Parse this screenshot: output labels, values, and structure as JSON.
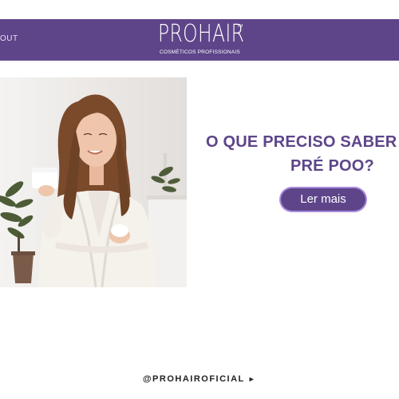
{
  "header": {
    "nav_left": "OUT",
    "logo": {
      "title": "PROHAIR",
      "trademark": "TM",
      "subtitle": "COSMÉTICOS PROFISSIONAIS"
    },
    "background_color": "#5e4589"
  },
  "hero": {
    "headline_line1": "O QUE PRECISO SABER",
    "headline_line2": "PRÉ POO?",
    "button_label": "Ler mais"
  },
  "footer": {
    "instagram_handle": "@PROHAIROFICIAL",
    "arrow": "►"
  },
  "colors": {
    "brand_purple": "#5e4589",
    "button_outline": "#a98cdd"
  }
}
